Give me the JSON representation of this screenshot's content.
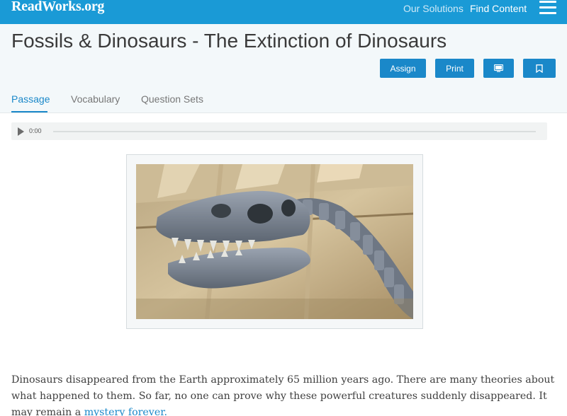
{
  "nav": {
    "logo": "ReadWorks",
    "logo_tld": ".org",
    "our_solutions": "Our Solutions",
    "find_content": "Find Content",
    "menu_icon": "hamburger-icon"
  },
  "article": {
    "title": "Fossils & Dinosaurs - The Extinction of Dinosaurs"
  },
  "actions": {
    "assign": "Assign",
    "print": "Print",
    "present_icon": "monitor-icon",
    "bookmark_icon": "bookmark-icon"
  },
  "tabs": {
    "passage": "Passage",
    "vocabulary": "Vocabulary",
    "question_sets": "Question Sets",
    "active": "Passage"
  },
  "audio": {
    "time": "0:00",
    "progress": 0
  },
  "passage": {
    "text_main": "Dinosaurs disappeared from the Earth approximately 65 million years ago. There are many theories about what happened to them. So far, no one can prove why these powerful creatures suddenly disappeared. It may remain a ",
    "text_link": "mystery forever."
  },
  "colors": {
    "brand": "#1a9ad6",
    "accent": "#1a88c9",
    "header_bg": "#f3f8fa"
  }
}
